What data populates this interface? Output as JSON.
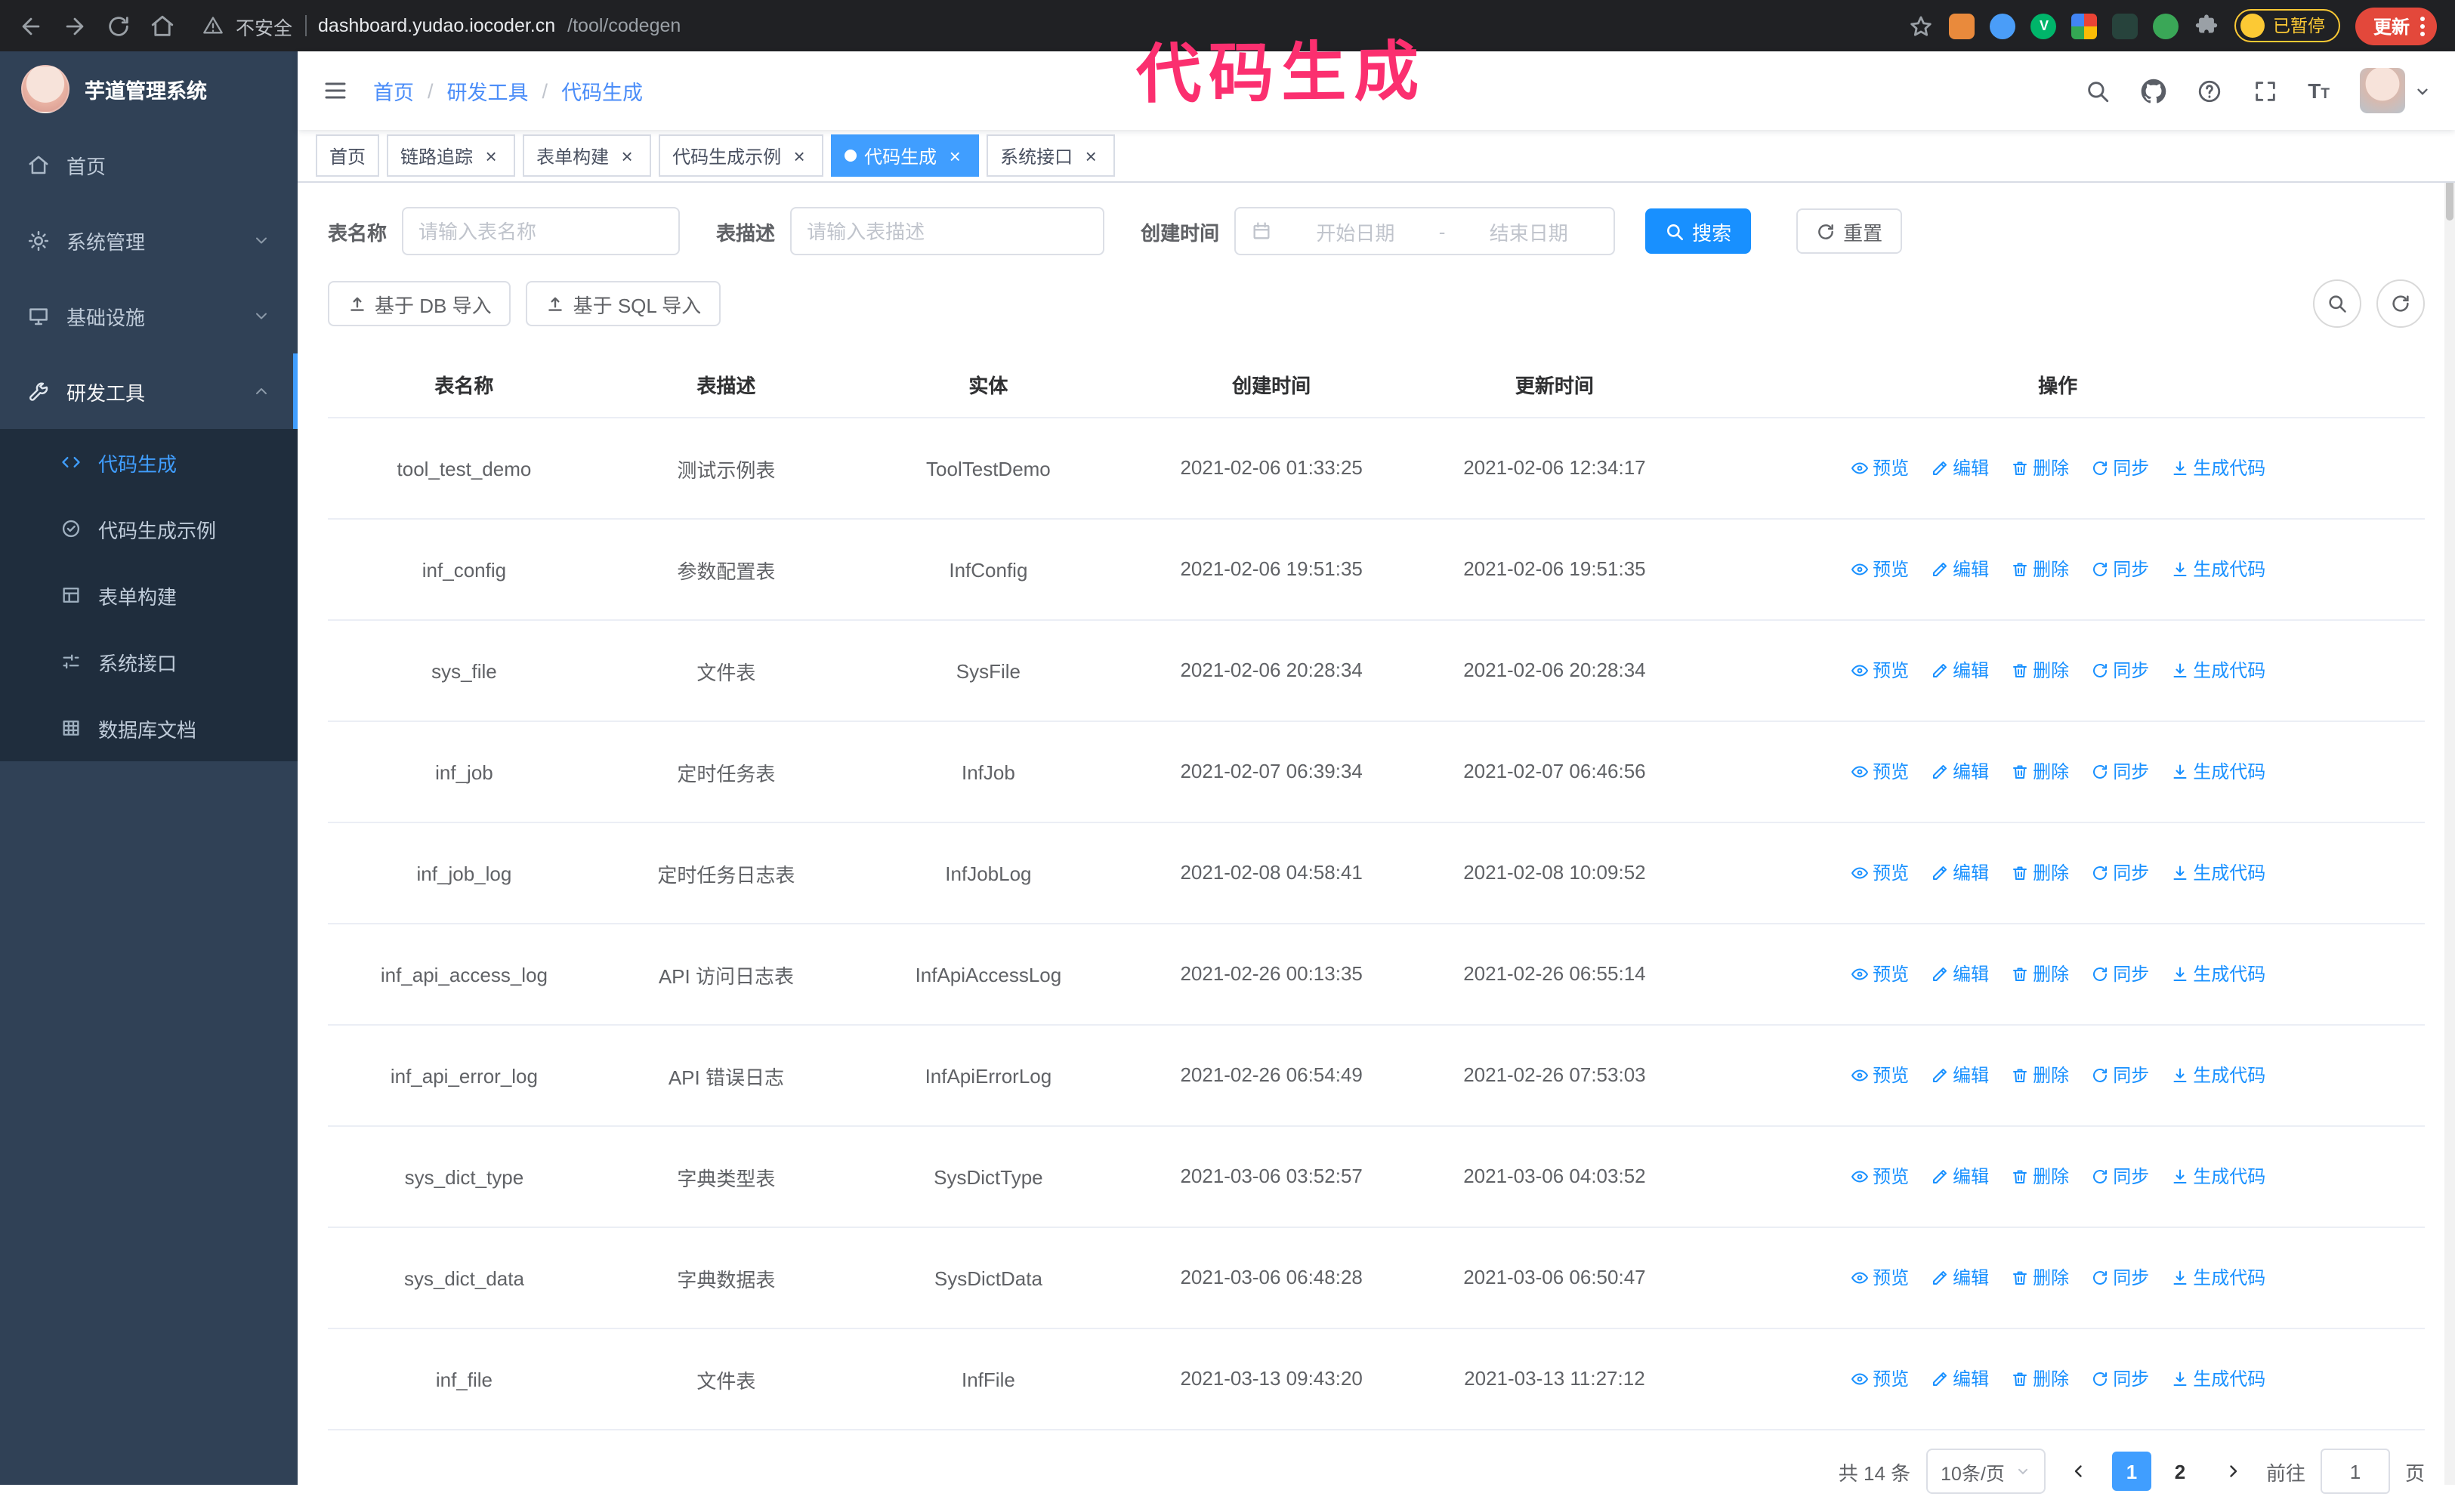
{
  "browser": {
    "security_label": "不安全",
    "url_host": "dashboard.yudao.iocoder.cn",
    "url_path": "/tool/codegen",
    "paused_badge": "已暂停",
    "update_button": "更新"
  },
  "annotation": {
    "text": "代码生成",
    "color": "#fb2f6f"
  },
  "sidebar": {
    "logo_title": "芋道管理系统",
    "items": [
      {
        "label": "首页",
        "slug": "home",
        "icon": "home-icon"
      },
      {
        "label": "系统管理",
        "slug": "system-management",
        "icon": "gear-icon",
        "chevron": "down"
      },
      {
        "label": "基础设施",
        "slug": "infrastructure",
        "icon": "infra-icon",
        "chevron": "down"
      },
      {
        "label": "研发工具",
        "slug": "dev-tools",
        "icon": "tools-icon",
        "chevron": "up",
        "active": true
      }
    ],
    "subitems": [
      {
        "label": "代码生成",
        "slug": "codegen",
        "icon": "code-icon",
        "active": true
      },
      {
        "label": "代码生成示例",
        "slug": "codegen-example",
        "icon": "badge-icon"
      },
      {
        "label": "表单构建",
        "slug": "form-builder",
        "icon": "form-icon"
      },
      {
        "label": "系统接口",
        "slug": "system-api",
        "icon": "api-icon"
      },
      {
        "label": "数据库文档",
        "slug": "db-doc",
        "icon": "db-icon"
      }
    ]
  },
  "header": {
    "breadcrumb": [
      "首页",
      "研发工具",
      "代码生成"
    ]
  },
  "tabs": [
    {
      "label": "首页",
      "slug": "home",
      "closable": false,
      "active": false
    },
    {
      "label": "链路追踪",
      "slug": "tracing",
      "closable": true,
      "active": false
    },
    {
      "label": "表单构建",
      "slug": "form-builder",
      "closable": true,
      "active": false
    },
    {
      "label": "代码生成示例",
      "slug": "codegen-example",
      "closable": true,
      "active": false
    },
    {
      "label": "代码生成",
      "slug": "codegen",
      "closable": true,
      "active": true
    },
    {
      "label": "系统接口",
      "slug": "system-api",
      "closable": true,
      "active": false
    }
  ],
  "filters": {
    "table_name_label": "表名称",
    "table_name_placeholder": "请输入表名称",
    "table_desc_label": "表描述",
    "table_desc_placeholder": "请输入表描述",
    "create_time_label": "创建时间",
    "date_start_placeholder": "开始日期",
    "date_separator": "-",
    "date_end_placeholder": "结束日期",
    "search_button": "搜索",
    "reset_button": "重置"
  },
  "toolbar": {
    "import_db": "基于 DB 导入",
    "import_sql": "基于 SQL 导入"
  },
  "table": {
    "columns": [
      "表名称",
      "表描述",
      "实体",
      "创建时间",
      "更新时间",
      "操作"
    ],
    "ops": [
      {
        "label": "预览",
        "slug": "preview",
        "icon": "eye-icon"
      },
      {
        "label": "编辑",
        "slug": "edit",
        "icon": "edit-icon"
      },
      {
        "label": "删除",
        "slug": "delete",
        "icon": "trash-icon"
      },
      {
        "label": "同步",
        "slug": "sync",
        "icon": "sync-icon"
      },
      {
        "label": "生成代码",
        "slug": "generate",
        "icon": "download-icon"
      }
    ],
    "rows": [
      {
        "name": "tool_test_demo",
        "desc": "测试示例表",
        "entity": "ToolTestDemo",
        "created": "2021-02-06 01:33:25",
        "updated": "2021-02-06 12:34:17"
      },
      {
        "name": "inf_config",
        "desc": "参数配置表",
        "entity": "InfConfig",
        "created": "2021-02-06 19:51:35",
        "updated": "2021-02-06 19:51:35"
      },
      {
        "name": "sys_file",
        "desc": "文件表",
        "entity": "SysFile",
        "created": "2021-02-06 20:28:34",
        "updated": "2021-02-06 20:28:34"
      },
      {
        "name": "inf_job",
        "desc": "定时任务表",
        "entity": "InfJob",
        "created": "2021-02-07 06:39:34",
        "updated": "2021-02-07 06:46:56"
      },
      {
        "name": "inf_job_log",
        "desc": "定时任务日志表",
        "entity": "InfJobLog",
        "created": "2021-02-08 04:58:41",
        "updated": "2021-02-08 10:09:52"
      },
      {
        "name": "inf_api_access_log",
        "desc": "API 访问日志表",
        "entity": "InfApiAccessLog",
        "created": "2021-02-26 00:13:35",
        "updated": "2021-02-26 06:55:14"
      },
      {
        "name": "inf_api_error_log",
        "desc": "API 错误日志",
        "entity": "InfApiErrorLog",
        "created": "2021-02-26 06:54:49",
        "updated": "2021-02-26 07:53:03"
      },
      {
        "name": "sys_dict_type",
        "desc": "字典类型表",
        "entity": "SysDictType",
        "created": "2021-03-06 03:52:57",
        "updated": "2021-03-06 04:03:52"
      },
      {
        "name": "sys_dict_data",
        "desc": "字典数据表",
        "entity": "SysDictData",
        "created": "2021-03-06 06:48:28",
        "updated": "2021-03-06 06:50:47"
      },
      {
        "name": "inf_file",
        "desc": "文件表",
        "entity": "InfFile",
        "created": "2021-03-13 09:43:20",
        "updated": "2021-03-13 11:27:12"
      }
    ]
  },
  "pagination": {
    "total": "共 14 条",
    "page_size": "10条/页",
    "pages": [
      "1",
      "2"
    ],
    "active_page": "1",
    "goto_label": "前往",
    "goto_value": "1",
    "goto_suffix": "页"
  }
}
